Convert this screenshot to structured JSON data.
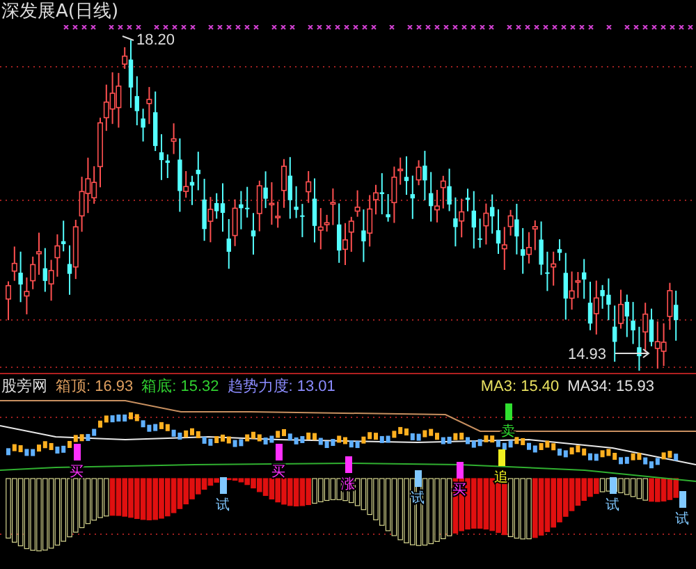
{
  "title": "深发展A(日线)",
  "high_label": "18.20",
  "low_label": "14.93",
  "indicator": {
    "name": "股旁网",
    "values": [
      {
        "label": "箱顶:",
        "value": "16.93",
        "color": "#e0a060"
      },
      {
        "label": "箱底:",
        "value": "15.32",
        "color": "#30d030"
      },
      {
        "label": "趋势力度:",
        "value": "13.01",
        "color": "#8c8cff"
      }
    ],
    "ma": [
      {
        "label": "MA3:",
        "value": "15.40",
        "color": "#e8e060"
      },
      {
        "label": "MA34:",
        "value": "15.93",
        "color": "#e0e0e0"
      }
    ]
  },
  "signals": [
    {
      "text": "买",
      "color": "#ff30ff"
    },
    {
      "text": "试",
      "color": "#80c8ff"
    },
    {
      "text": "买",
      "color": "#ff30ff"
    },
    {
      "text": "涨",
      "color": "#ff30ff"
    },
    {
      "text": "试",
      "color": "#80c8ff"
    },
    {
      "text": "买",
      "color": "#ff30ff"
    },
    {
      "text": "卖",
      "color": "#30e030"
    },
    {
      "text": "追",
      "color": "#f0f020"
    },
    {
      "text": "试",
      "color": "#80c8ff"
    },
    {
      "text": "试",
      "color": "#80c8ff"
    }
  ]
}
